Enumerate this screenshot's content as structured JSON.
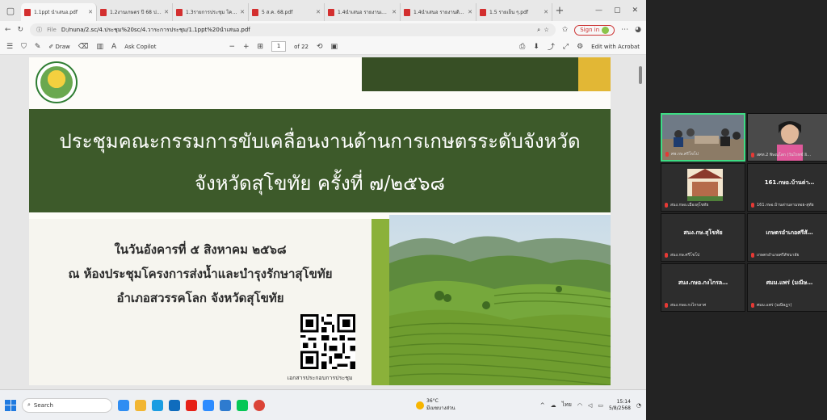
{
  "browser": {
    "tabs": [
      {
        "title": "1.1ppt นำเสนอ.pdf",
        "active": true
      },
      {
        "title": "1.2งานเกษตร ปี 68 ประ…",
        "active": false
      },
      {
        "title": "1.3รายการประชุม โครงการ…",
        "active": false
      },
      {
        "title": "5 ส.ค. 68.pdf",
        "active": false
      },
      {
        "title": "1.4นำเสนอ รายงานเกษตร…",
        "active": false
      },
      {
        "title": "1.4นำเสนอ รายงานดิจิทัล…",
        "active": false
      },
      {
        "title": "1.5 รายเย็น ๆ.pdf",
        "active": false
      }
    ],
    "address": {
      "scheme_label": "File",
      "url": "D:/nuna/2.sc/4.ประชุม%20sc/4.วาระการประชุม/1.1ppt%20นำเสนอ.pdf",
      "signin_label": "Sign in"
    },
    "pdf_toolbar": {
      "draw_label": "Draw",
      "copilot_label": "Ask Copilot",
      "page_current": "1",
      "page_total": "of 22",
      "edit_label": "Edit with Acrobat"
    }
  },
  "slide": {
    "title_line1": "ประชุมคณะกรรมการขับเคลื่อนงานด้านการเกษตรระดับจังหวัด",
    "title_line2": "จังหวัดสุโขทัย  ครั้งที่  ๗/๒๕๖๘",
    "date_line": "ในวันอังคารที่  ๕  สิงหาคม  ๒๕๖๘",
    "venue_line": "ณ  ห้องประชุมโครงการส่งน้ำและบำรุงรักษาสุโขทัย",
    "district_line": "อำเภอสวรรคโลก  จังหวัดสุโขทัย",
    "qr_caption": "เอกสารประกอบการประชุม",
    "colors": {
      "band": "#3d5a2a",
      "gold": "#e2b735",
      "stripe": "#8bb13a"
    }
  },
  "taskbar": {
    "search_label": "Search",
    "weather_temp": "36°C",
    "weather_desc": "มีเมฆบางส่วน",
    "lang": "ไทย",
    "time": "15:14",
    "date": "5/8/2568"
  },
  "meeting": {
    "tiles": [
      {
        "label": "ศพ.กษ.ศรีโขโป",
        "video": true,
        "speaking": true
      },
      {
        "label": "สศท.2 พิษณุโลก (วันไรทช์ อิ…",
        "video": true,
        "speaking": false
      },
      {
        "label": "สนง.กษอ.เมืองสุโขทัย",
        "video": true,
        "speaking": false
      },
      {
        "name": "161.กษอ.บ้านด่า…",
        "label": "161.กษอ.บ้านด่านลานหอย-สุทัย",
        "video": false
      },
      {
        "name": "สนง.กษ.สุโขทัย",
        "label": "สนง.กษ.ศรีโขโป",
        "video": false
      },
      {
        "name": "เกษตรอำเภอศรีสั…",
        "label": "เกษตรอำเภอศรีสัชนาลัย",
        "video": false
      },
      {
        "name": "สนง.กษอ.กงไกรล…",
        "label": "สนง.กษอ.กงไกรลาศ",
        "video": false
      },
      {
        "name": "ศมม.แพร่ (มณีษ…",
        "label": "ศมม.แพร่ (มณีษฎา)",
        "video": false
      }
    ]
  }
}
